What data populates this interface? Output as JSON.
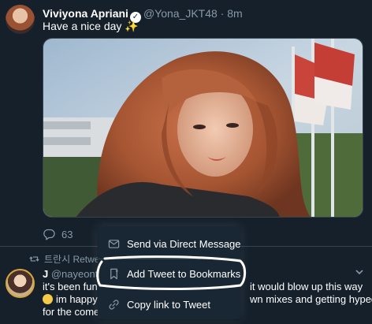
{
  "tweet1": {
    "author_name": "Viviyona Apriani",
    "handle": "@Yona_JKT48",
    "separator": "·",
    "time": "8m",
    "text": "Have a nice day ✨",
    "reply_count": "63"
  },
  "retweet_context": {
    "retweeter": "트란시 Retweeted"
  },
  "tweet2": {
    "author_name": "J",
    "handle": "@nayeonth",
    "line1_left": "it's been fun",
    "line1_right": "it would blow up this way",
    "line2_left": "im happy",
    "line2_right": "wn mixes and getting hyped",
    "line3": "for the comeb"
  },
  "share_menu": {
    "items": [
      {
        "label": "Send via Direct Message",
        "icon": "envelope-icon"
      },
      {
        "label": "Add Tweet to Bookmarks",
        "icon": "bookmark-icon"
      },
      {
        "label": "Copy link to Tweet",
        "icon": "link-icon"
      }
    ]
  },
  "colors": {
    "background": "#15202b",
    "menu_background": "#192734",
    "muted_text": "#8899a6",
    "divider": "#38444d",
    "accent_highlight": "#ffffff"
  }
}
